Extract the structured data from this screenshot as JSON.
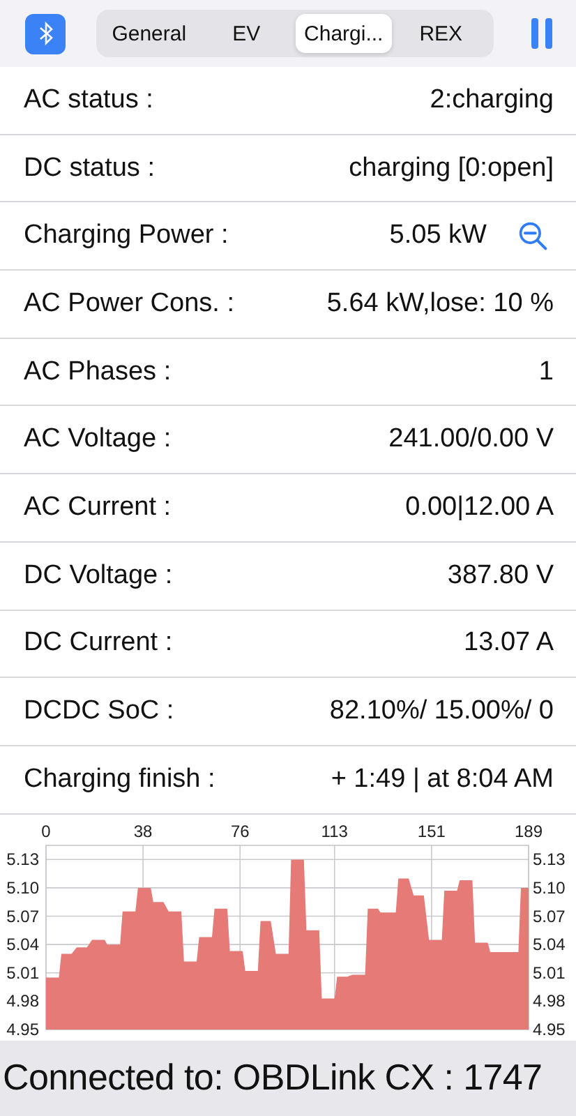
{
  "tabs": [
    {
      "label": "General",
      "selected": false
    },
    {
      "label": "EV",
      "selected": false
    },
    {
      "label": "Chargi...",
      "selected": true
    },
    {
      "label": "REX",
      "selected": false
    }
  ],
  "rows": [
    {
      "label": "AC status :",
      "value": "2:charging",
      "kind": "plain"
    },
    {
      "label": "DC status :",
      "value": "charging [0:open]",
      "kind": "plain"
    },
    {
      "label": "Charging Power :",
      "value": "5.05 kW",
      "kind": "zoom"
    },
    {
      "label": "AC Power Cons. :",
      "value": "5.64 kW,lose: 10 %",
      "kind": "plain"
    },
    {
      "label": "AC Phases :",
      "value": "1",
      "kind": "plain"
    },
    {
      "label": "AC Voltage :",
      "value": "241.00/0.00 V",
      "kind": "plain"
    },
    {
      "label": "AC Current :",
      "value": "0.00|12.00 A",
      "kind": "plain"
    },
    {
      "label": "DC Voltage :",
      "value": "387.80 V",
      "kind": "plain"
    },
    {
      "label": "DC Current :",
      "value": "13.07 A",
      "kind": "plain"
    },
    {
      "label": "DCDC SoC :",
      "value": "82.10%/ 15.00%/ 0",
      "kind": "plain"
    },
    {
      "label": "Charging finish :",
      "value": "+ 1:49 | at 8:04 AM",
      "kind": "plain"
    }
  ],
  "chart": {
    "chart_data": {
      "type": "area",
      "x": [
        0,
        5,
        6,
        10,
        12,
        16,
        18,
        23,
        24,
        29,
        30,
        35,
        36,
        41,
        42,
        46,
        48,
        53,
        54,
        59,
        60,
        65,
        66,
        71,
        72,
        77,
        78,
        83,
        84,
        88,
        90,
        95,
        96,
        101,
        102,
        107,
        108,
        113,
        114,
        118,
        120,
        125,
        126,
        130,
        131,
        137,
        138,
        142,
        144,
        148,
        150,
        155,
        156,
        161,
        162,
        167,
        168,
        173,
        174,
        179,
        180,
        185,
        186,
        189
      ],
      "grid": true,
      "series": [
        {
          "color": "#e57a76",
          "values": [
            5.005,
            5.005,
            5.03,
            5.03,
            5.037,
            5.037,
            5.045,
            5.045,
            5.04,
            5.04,
            5.075,
            5.075,
            5.1,
            5.1,
            5.085,
            5.085,
            5.075,
            5.075,
            5.022,
            5.022,
            5.048,
            5.048,
            5.078,
            5.078,
            5.033,
            5.033,
            5.012,
            5.012,
            5.065,
            5.065,
            5.03,
            5.03,
            5.13,
            5.13,
            5.055,
            5.055,
            4.983,
            4.983,
            5.006,
            5.006,
            5.008,
            5.008,
            5.078,
            5.078,
            5.074,
            5.074,
            5.11,
            5.11,
            5.092,
            5.092,
            5.045,
            5.045,
            5.097,
            5.097,
            5.108,
            5.108,
            5.042,
            5.042,
            5.032,
            5.032,
            5.032,
            5.032,
            5.1,
            5.1
          ]
        }
      ],
      "xlim": [
        0,
        189
      ],
      "ylim": [
        4.95,
        5.145
      ],
      "xticks": [
        0,
        38,
        76,
        113,
        151,
        189
      ],
      "yticks": [
        {
          "value": 4.95,
          "label": "4.95"
        },
        {
          "value": 4.98,
          "label": "4.98"
        },
        {
          "value": 5.01,
          "label": "5.01"
        },
        {
          "value": 5.04,
          "label": "5.04"
        },
        {
          "value": 5.07,
          "label": "5.07"
        },
        {
          "value": 5.1,
          "label": "5.10"
        },
        {
          "value": 5.13,
          "label": "5.13"
        }
      ]
    }
  },
  "status_bar": {
    "text": "Connected to: OBDLink CX : 1747"
  }
}
